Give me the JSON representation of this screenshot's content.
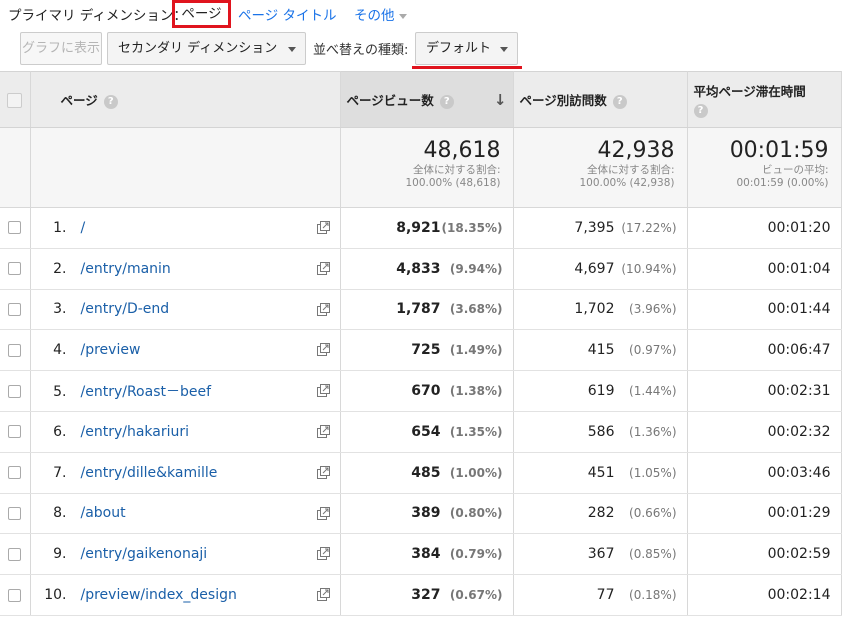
{
  "dimension_bar": {
    "label": "プライマリ ディメンション：",
    "active": "ページ",
    "links": [
      "ページ タイトル",
      "その他"
    ]
  },
  "toolbar": {
    "graph_button": "グラフに表示",
    "secondary_dimension": "セカンダリ ディメンション",
    "sort_label": "並べ替えの種類:",
    "sort_value": "デフォルト"
  },
  "table": {
    "headers": {
      "page": "ページ",
      "pageviews": "ページビュー数",
      "unique_pageviews": "ページ別訪問数",
      "avg_time": "平均ページ滞在時間"
    },
    "summary": {
      "pageviews": {
        "value": "48,618",
        "line1": "全体に対する割合:",
        "line2": "100.00% (48,618)"
      },
      "unique_pageviews": {
        "value": "42,938",
        "line1": "全体に対する割合:",
        "line2": "100.00% (42,938)"
      },
      "avg_time": {
        "value": "00:01:59",
        "line1": "ビューの平均:",
        "line2": "00:01:59 (0.00%)"
      }
    },
    "rows": [
      {
        "num": "1.",
        "page": "/",
        "pv": "8,921",
        "pv_pct": "(18.35%)",
        "upv": "7,395",
        "upv_pct": "(17.22%)",
        "time": "00:01:20"
      },
      {
        "num": "2.",
        "page": "/entry/manin",
        "pv": "4,833",
        "pv_pct": "(9.94%)",
        "upv": "4,697",
        "upv_pct": "(10.94%)",
        "time": "00:01:04"
      },
      {
        "num": "3.",
        "page": "/entry/D-end",
        "pv": "1,787",
        "pv_pct": "(3.68%)",
        "upv": "1,702",
        "upv_pct": "(3.96%)",
        "time": "00:01:44"
      },
      {
        "num": "4.",
        "page": "/preview",
        "pv": "725",
        "pv_pct": "(1.49%)",
        "upv": "415",
        "upv_pct": "(0.97%)",
        "time": "00:06:47"
      },
      {
        "num": "5.",
        "page": "/entry/Roast－beef",
        "pv": "670",
        "pv_pct": "(1.38%)",
        "upv": "619",
        "upv_pct": "(1.44%)",
        "time": "00:02:31"
      },
      {
        "num": "6.",
        "page": "/entry/hakariuri",
        "pv": "654",
        "pv_pct": "(1.35%)",
        "upv": "586",
        "upv_pct": "(1.36%)",
        "time": "00:02:32"
      },
      {
        "num": "7.",
        "page": "/entry/dille&kamille",
        "pv": "485",
        "pv_pct": "(1.00%)",
        "upv": "451",
        "upv_pct": "(1.05%)",
        "time": "00:03:46"
      },
      {
        "num": "8.",
        "page": "/about",
        "pv": "389",
        "pv_pct": "(0.80%)",
        "upv": "282",
        "upv_pct": "(0.66%)",
        "time": "00:01:29"
      },
      {
        "num": "9.",
        "page": "/entry/gaikenonaji",
        "pv": "384",
        "pv_pct": "(0.79%)",
        "upv": "367",
        "upv_pct": "(0.85%)",
        "time": "00:02:59"
      },
      {
        "num": "10.",
        "page": "/preview/index_design",
        "pv": "327",
        "pv_pct": "(0.67%)",
        "upv": "77",
        "upv_pct": "(0.18%)",
        "time": "00:02:14"
      }
    ]
  },
  "icons": {
    "help": "help-icon",
    "sort": "sort-down-arrow-icon",
    "external": "open-in-new-window-icon"
  },
  "colors": {
    "accent_red": "#e0141e",
    "link_blue": "#1a73e8"
  }
}
